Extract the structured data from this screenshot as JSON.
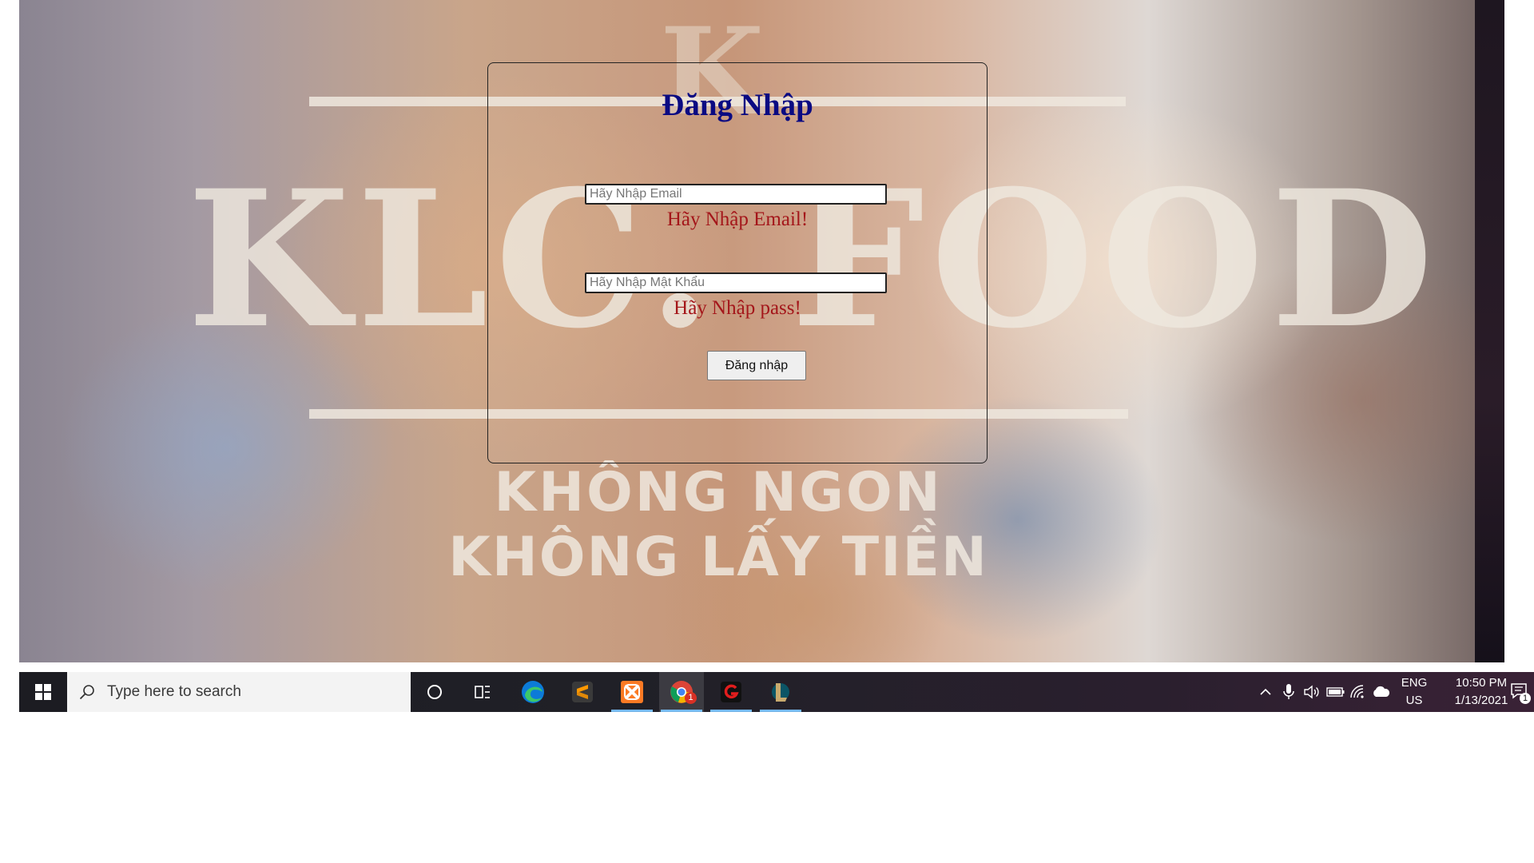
{
  "background": {
    "brand_name": "KLC. FOOD",
    "brand_initial": "K",
    "slogan_line_1": "KHÔNG NGON",
    "slogan_line_2": "KHÔNG LẤY TIỀN"
  },
  "login": {
    "title": "Đăng Nhập",
    "email_placeholder": "Hãy Nhập Email",
    "email_value": "",
    "email_error": "Hãy Nhập Email!",
    "password_placeholder": "Hãy Nhập Mật Khẩu",
    "password_value": "",
    "password_error": "Hãy Nhập pass!",
    "submit_label": "Đăng nhập",
    "colors": {
      "title": "#0a0a82",
      "error": "#a4161a"
    }
  },
  "taskbar": {
    "search_placeholder": "Type here to search",
    "pinned_apps": [
      {
        "name": "cortana-icon",
        "active": false
      },
      {
        "name": "task-view-icon",
        "active": false
      },
      {
        "name": "edge-icon",
        "active": false
      },
      {
        "name": "sublime-text-icon",
        "active": false
      },
      {
        "name": "xampp-icon",
        "active": true
      },
      {
        "name": "chrome-icon",
        "active": true,
        "badge": "1"
      },
      {
        "name": "garena-icon",
        "active": true
      },
      {
        "name": "league-of-legends-icon",
        "active": true
      }
    ],
    "tray": {
      "language_line_1": "ENG",
      "language_line_2": "US",
      "time": "10:50 PM",
      "date": "1/13/2021",
      "notification_count": "1"
    }
  }
}
